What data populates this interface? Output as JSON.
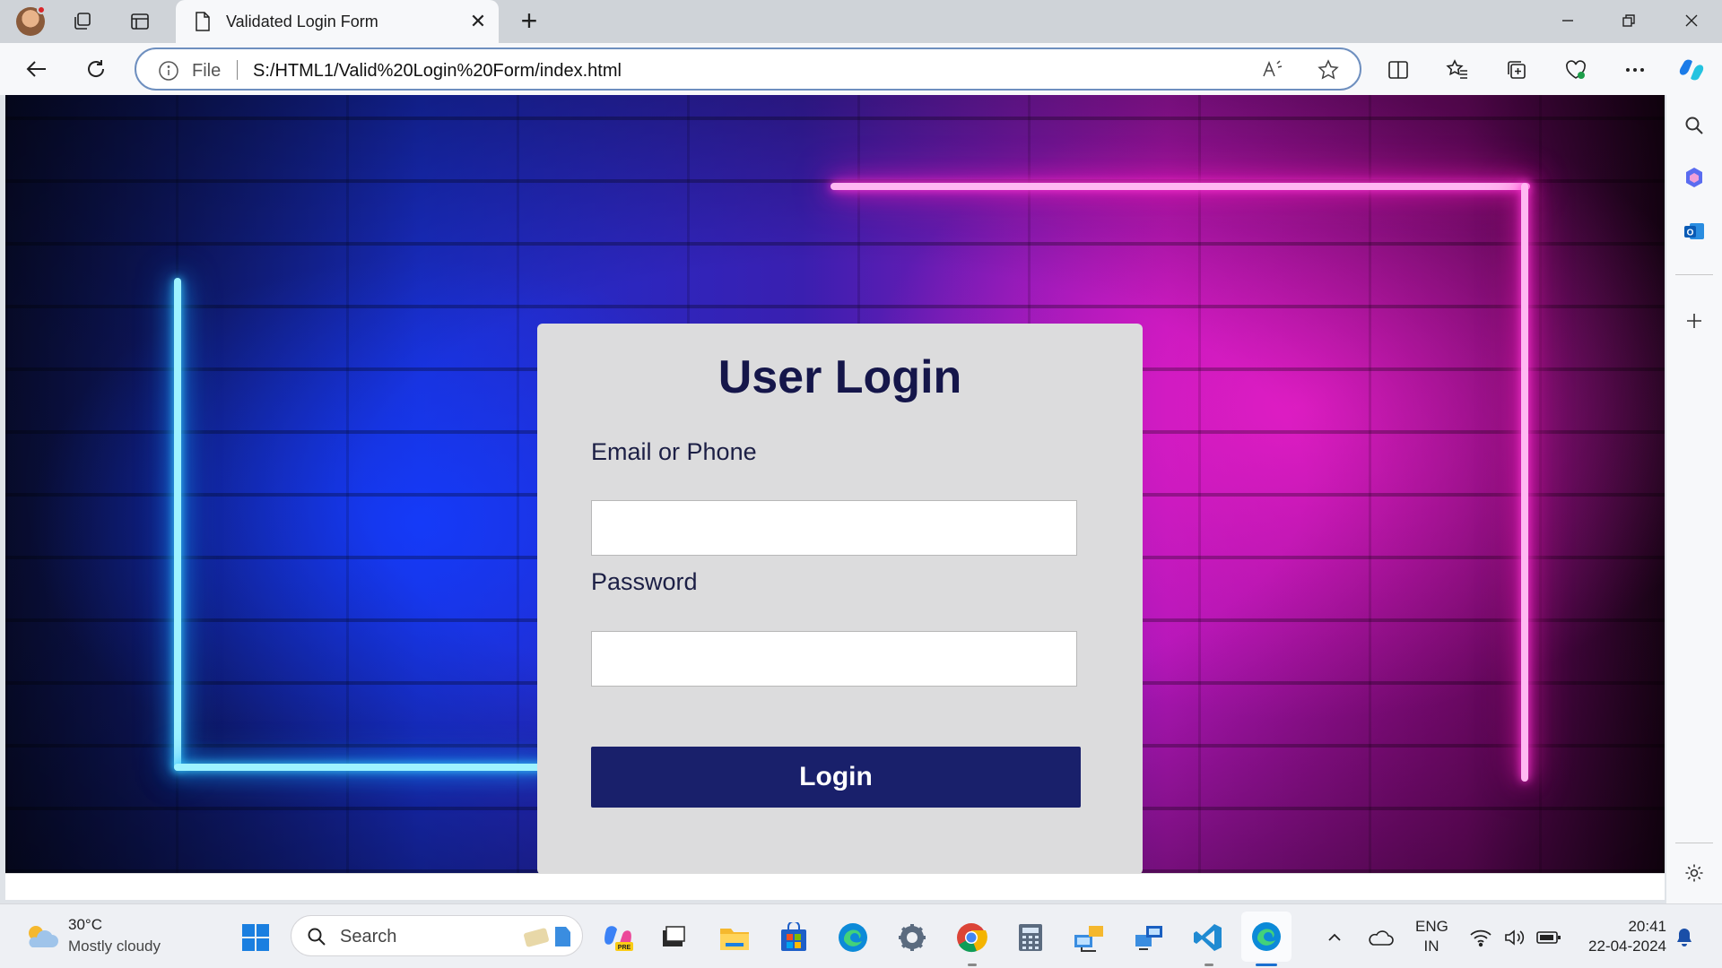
{
  "browser": {
    "tab_title": "Validated Login Form",
    "address": {
      "scheme_label": "File",
      "url": "S:/HTML1/Valid%20Login%20Form/index.html"
    }
  },
  "login": {
    "title": "User Login",
    "email_label": "Email or Phone",
    "email_value": "",
    "password_label": "Password",
    "password_value": "",
    "button_label": "Login"
  },
  "taskbar": {
    "weather": {
      "temp": "30°C",
      "desc": "Mostly cloudy"
    },
    "search_label": "Search",
    "lang_1": "ENG",
    "lang_2": "IN",
    "time": "20:41",
    "date": "22-04-2024"
  },
  "colors": {
    "accent": "#19206b",
    "card_bg": "#dcdcdd",
    "title_color": "#15164a"
  }
}
